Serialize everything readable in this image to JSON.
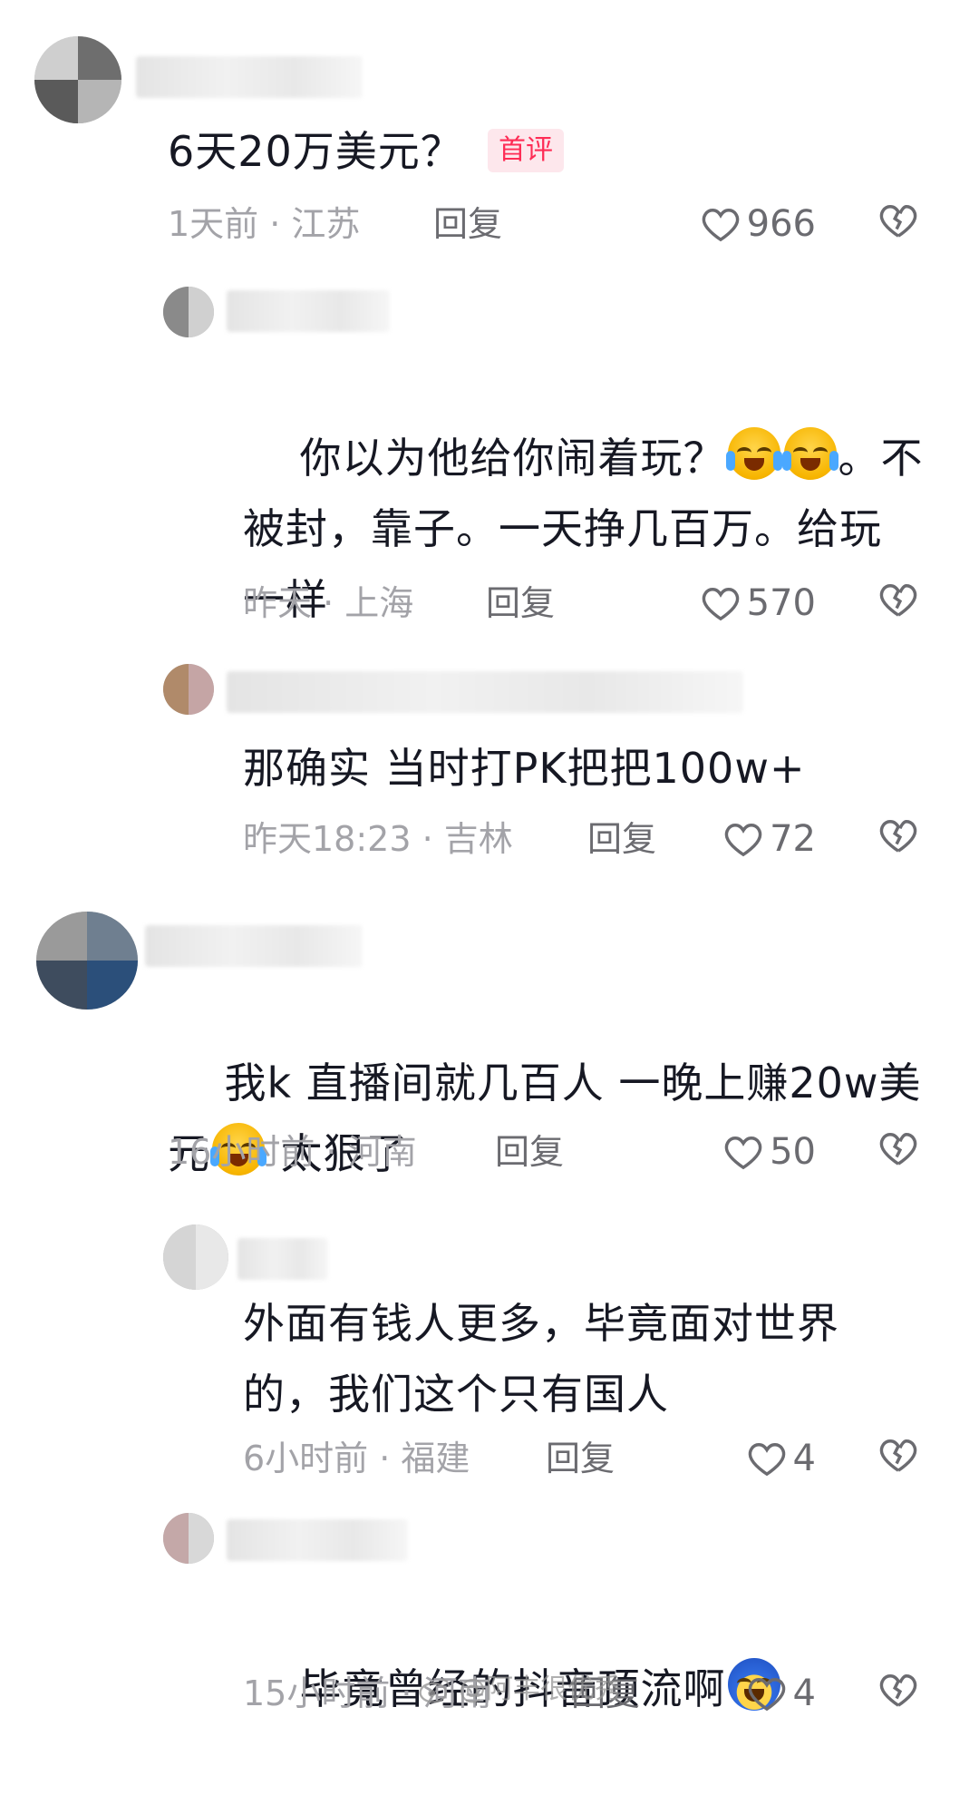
{
  "comments": [
    {
      "text": "6天20万美元？",
      "badge": "首评",
      "meta": "1天前 · 江苏",
      "reply": "回复",
      "likes": "966"
    },
    {
      "text_a": "你以为他给你闹着玩？",
      "text_b": "。不\n被封，靠子。一天挣几百万。给玩\n一样",
      "emoji": [
        "laugh-cry-emoji",
        "laugh-cry-emoji"
      ],
      "meta": "昨天 · 上海",
      "reply": "回复",
      "likes": "570"
    },
    {
      "text": "那确实 当时打PK把把100w+",
      "meta": "昨天18:23 · 吉林",
      "reply": "回复",
      "likes": "72"
    },
    {
      "text_a": "我k 直播间就几百人 一晚上赚20w美\n元",
      "text_b": " 太狠了",
      "emoji": [
        "laugh-cry-emoji"
      ],
      "meta": "16小时前 · 河南",
      "reply": "回复",
      "likes": "50"
    },
    {
      "text": "外面有钱人更多，毕竟面对世界\n的，我们这个只有国人",
      "meta": "6小时前 · 福建",
      "reply": "回复",
      "likes": "4"
    },
    {
      "text_a": "毕竟曾经的抖音顶流啊",
      "emoji": [
        "cold-sweat-emoji"
      ],
      "meta": "15小时前 · 河南",
      "reply": "回复",
      "likes": "4"
    }
  ],
  "watermark": "@阿丰很优秀",
  "colors": {
    "text": "#161823",
    "meta": "#a3a3a8",
    "accent": "#fe2c55",
    "badge_bg": "#fde7ec"
  }
}
